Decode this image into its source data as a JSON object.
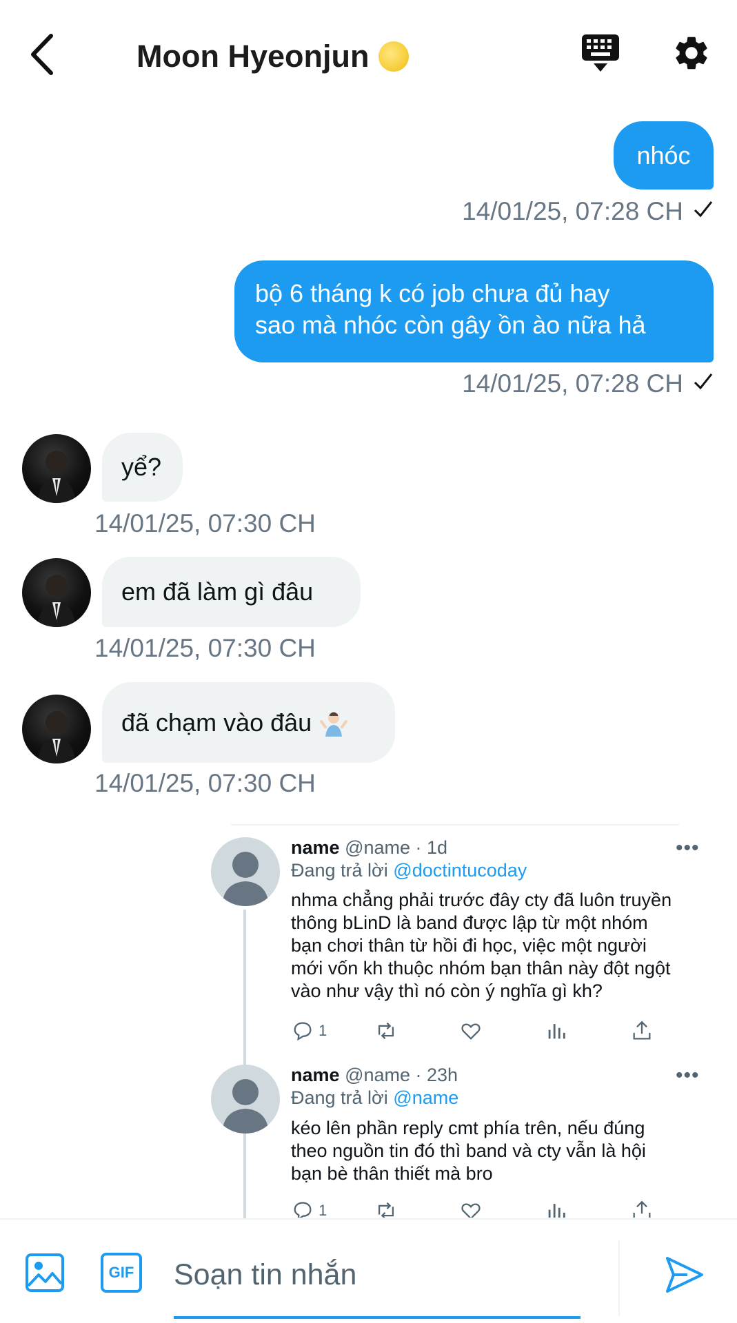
{
  "header": {
    "back_icon": "chevron-left-icon",
    "title": "Moon Hyeonjun",
    "title_emoji": "full-moon-emoji",
    "keyboard_icon": "keyboard-icon",
    "settings_icon": "gear-icon"
  },
  "messages": [
    {
      "direction": "out",
      "text": "nhóc",
      "time": "14/01/25, 07:28 CH"
    },
    {
      "direction": "out",
      "lines": [
        "bộ 6 tháng k có job chưa đủ hay",
        "sao mà nhóc còn gây ồn ào nữa hả"
      ],
      "time": "14/01/25, 07:28 CH"
    },
    {
      "direction": "in",
      "text": "yể?",
      "time": "14/01/25, 07:30 CH"
    },
    {
      "direction": "in",
      "text": "em đã làm gì đâu",
      "time": "14/01/25, 07:30 CH"
    },
    {
      "direction": "in",
      "text": "đã chạm vào đâu",
      "emoji": "person-shrugging-emoji",
      "time": "14/01/25, 07:30 CH"
    }
  ],
  "tweets": [
    {
      "name": "name",
      "handle": "@name · 1d",
      "reply_prefix": "Đang trả lời",
      "reply_to": "@doctintucoday",
      "text": "nhma chẳng phải trước đây cty đã luôn truyền\nthông bLinD là band được lập từ một nhóm\nbạn chơi thân từ hồi đi học, việc một người\nmới vốn kh thuộc nhóm bạn thân này đột ngột\nvào như vậy thì nó còn ý nghĩa gì kh?",
      "reply_count": "1",
      "more": "•••"
    },
    {
      "name": "name",
      "handle": "@name · 23h",
      "reply_prefix": "Đang trả lời",
      "reply_to": "@name",
      "text": "kéo lên phần reply cmt phía trên, nếu đúng\ntheo nguồn tin đó thì band và cty vẫn là hội\nbạn bè thân thiết mà bro",
      "reply_count": "1",
      "more": "•••"
    }
  ],
  "composer": {
    "placeholder": "Soạn tin nhắn",
    "gif_label": "GIF",
    "accent": "#1d9bf0"
  },
  "colors": {
    "outgoing_bubble": "#1d9bf0",
    "incoming_bubble": "#eff3f4",
    "timestamp": "#687684"
  }
}
